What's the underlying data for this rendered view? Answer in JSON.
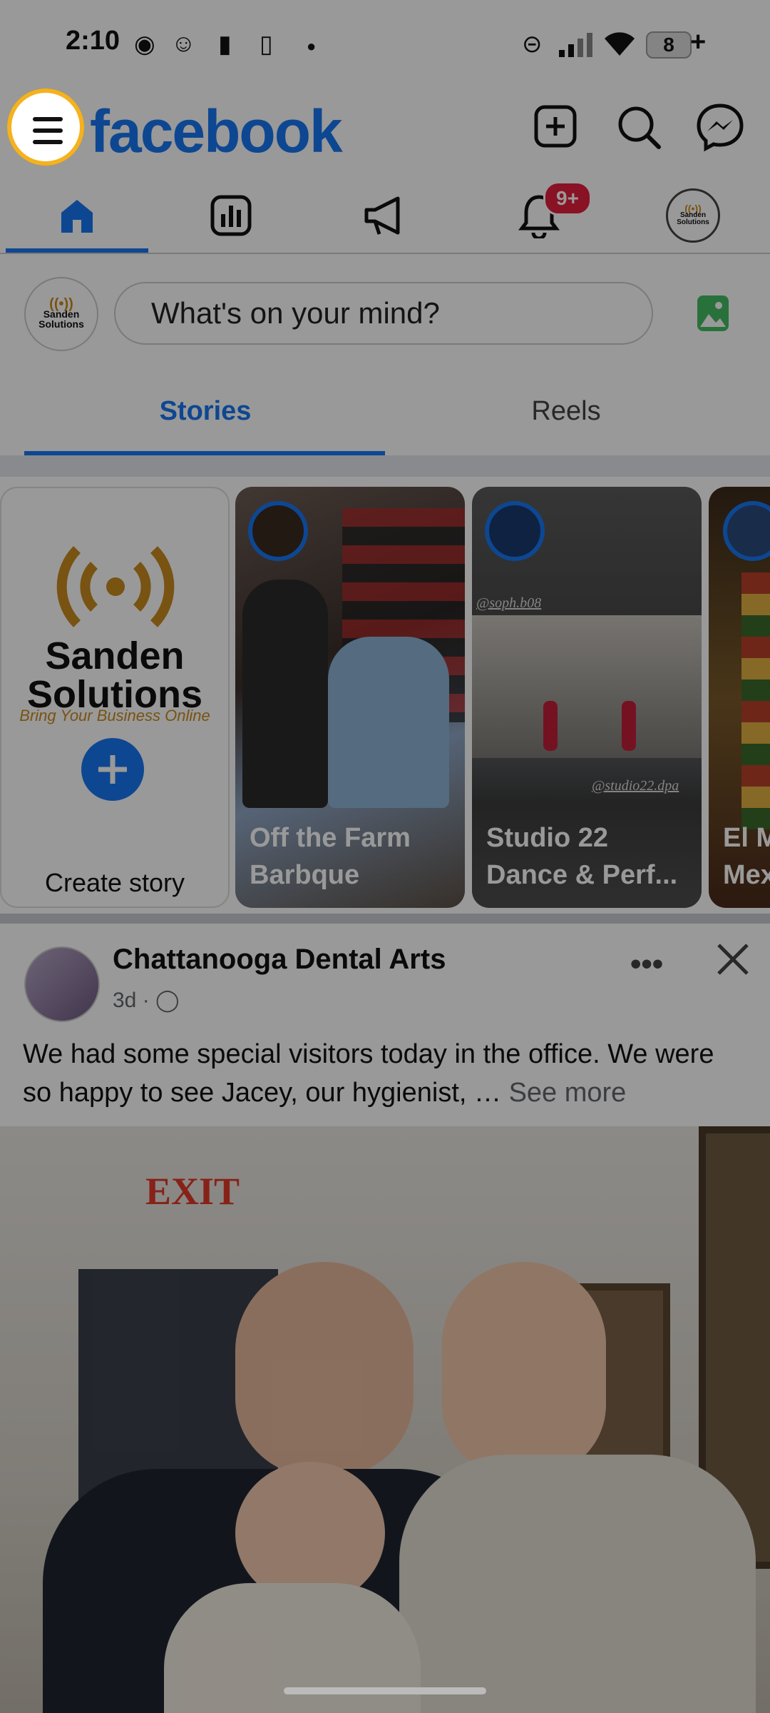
{
  "status_bar": {
    "time": "2:10",
    "battery": "8"
  },
  "header": {
    "logo": "facebook"
  },
  "nav": {
    "badge": "9+"
  },
  "composer": {
    "placeholder": "What's on your mind?",
    "avatar_line1": "Sanden",
    "avatar_line2": "Solutions"
  },
  "tabs": {
    "stories": "Stories",
    "reels": "Reels"
  },
  "stories": {
    "create": {
      "brand1": "Sanden",
      "brand2": "Solutions",
      "tagline": "Bring Your Business Online",
      "label": "Create story"
    },
    "items": [
      {
        "line1": "Off the Farm",
        "line2": "Barbque"
      },
      {
        "line1": "Studio 22",
        "line2": "Dance & Perf...",
        "handle1": "@soph.b08",
        "handle2": "@studio22.dpa"
      },
      {
        "line1": "El M",
        "line2": "Mex"
      }
    ]
  },
  "post": {
    "author": "Chattanooga Dental Arts",
    "time": "3d",
    "text": "We had some special visitors today in the office. We were so happy to see Jacey, our hygienist, …",
    "see_more": "See more",
    "photo_sign": "EXIT"
  },
  "colors": {
    "brand": "#1877f2",
    "highlight": "#f5b21e",
    "badge": "#e41e3f"
  }
}
